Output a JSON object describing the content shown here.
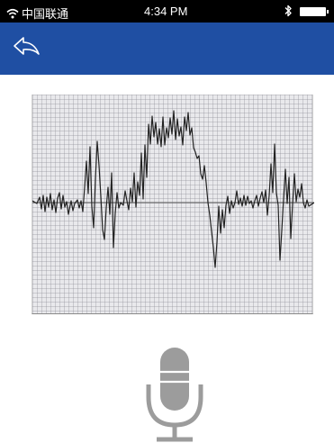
{
  "status_bar": {
    "carrier": "中国联通",
    "time": "4:34 PM",
    "wifi_icon": "wifi-icon",
    "bluetooth_icon": "bluetooth-icon",
    "battery_icon": "battery-icon"
  },
  "nav_bar": {
    "background_color": "#1f4fa3",
    "back_icon": "back-arrow-icon"
  },
  "waveform": {
    "icon": "audio-waveform"
  },
  "mic_button": {
    "icon": "microphone-icon",
    "color": "#9c9c9c"
  }
}
